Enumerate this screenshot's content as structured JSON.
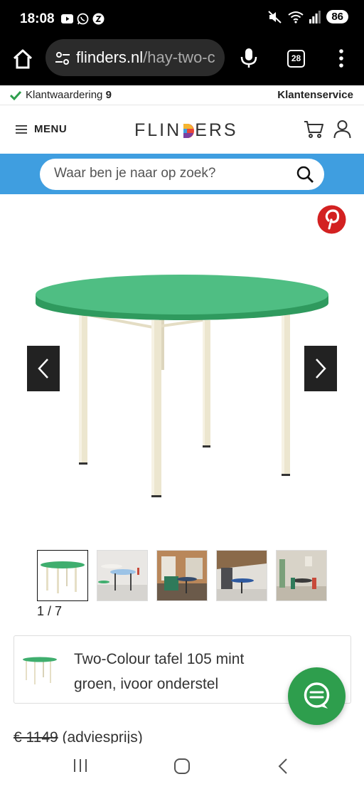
{
  "status_bar": {
    "time": "18:08",
    "battery": "86",
    "left_icons": [
      "youtube-icon",
      "whatsapp-icon",
      "app-notification-icon"
    ],
    "right_icons": [
      "mute-icon",
      "wifi-icon",
      "signal-icon"
    ]
  },
  "browser": {
    "url_host": "flinders.nl",
    "url_path": "/hay-two-c",
    "tab_count": "28"
  },
  "rating_strip": {
    "rating_label": "Klantwaardering",
    "rating_score": "9",
    "service_link": "Klantenservice"
  },
  "header": {
    "menu_label": "MENU",
    "logo_text_left": "FLIN",
    "logo_text_right": "ERS"
  },
  "search": {
    "placeholder": "Waar ben je naar op zoek?"
  },
  "gallery": {
    "counter": "1 / 7",
    "thumbnails": [
      "Thumbnail 1",
      "Thumbnail 2",
      "Thumbnail 3",
      "Thumbnail 4",
      "Thumbnail 5"
    ]
  },
  "product": {
    "title": "Two-Colour tafel 105 mint groen, ivoor onderstel",
    "old_price": "€ 1149",
    "price_note": " (adviesprijs)"
  },
  "colors": {
    "accent_blue": "#3f9ee0",
    "chat_green": "#2e9e4d",
    "table_top_green": "#3fae6e",
    "table_leg_ivory": "#ece6cf",
    "pinterest_red": "#d32121"
  }
}
